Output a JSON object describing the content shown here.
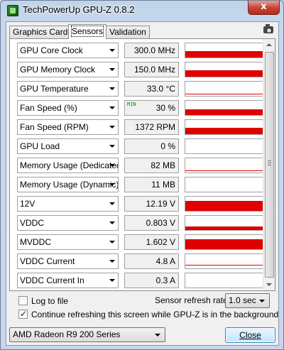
{
  "window": {
    "title": "TechPowerUp GPU-Z 0.8.2",
    "close_glyph": "x"
  },
  "tabs": [
    {
      "label": "Graphics Card",
      "active": false
    },
    {
      "label": "Sensors",
      "active": true
    },
    {
      "label": "Validation",
      "active": false
    }
  ],
  "toolbar": {
    "icon": "camera-icon"
  },
  "sensors": [
    {
      "name": "GPU Core Clock",
      "value": "300.0 MHz",
      "graph": "bar",
      "level": 0.45
    },
    {
      "name": "GPU Memory Clock",
      "value": "150.0 MHz",
      "graph": "bar",
      "level": 0.45
    },
    {
      "name": "GPU Temperature",
      "value": "33.0 °C",
      "graph": "line",
      "level": 0.1
    },
    {
      "name": "Fan Speed (%)",
      "value": "30 %",
      "min_label": "MIN",
      "graph": "bar",
      "level": 0.4
    },
    {
      "name": "Fan Speed (RPM)",
      "value": "1372 RPM",
      "graph": "bar",
      "level": 0.45
    },
    {
      "name": "GPU Load",
      "value": "0 %",
      "graph": "none",
      "level": 0
    },
    {
      "name": "Memory Usage (Dedicated)",
      "value": "82 MB",
      "graph": "line",
      "level": 0.1
    },
    {
      "name": "Memory Usage (Dynamic)",
      "value": "11 MB",
      "graph": "none",
      "level": 0
    },
    {
      "name": "12V",
      "value": "12.19 V",
      "graph": "bar",
      "level": 0.7
    },
    {
      "name": "VDDC",
      "value": "0.803 V",
      "graph": "bar",
      "level": 0.25
    },
    {
      "name": "MVDDC",
      "value": "1.602 V",
      "graph": "bar",
      "level": 0.7
    },
    {
      "name": "VDDC Current",
      "value": "4.8 A",
      "graph": "line",
      "level": 0.2
    },
    {
      "name": "VDDC Current In",
      "value": "0.3 A",
      "graph": "none",
      "level": 0
    }
  ],
  "options": {
    "log_to_file": {
      "label": "Log to file",
      "checked": false
    },
    "refresh_label": "Sensor refresh rate:",
    "refresh_value": "1.0 sec",
    "continue_refresh": {
      "label": "Continue refreshing this screen while GPU-Z is in the background",
      "checked": true
    }
  },
  "footer": {
    "gpu_select": "AMD Radeon R9 200 Series",
    "close_label": "Close"
  },
  "colors": {
    "graph": "#e00000",
    "min_label": "#0a8a0a"
  }
}
